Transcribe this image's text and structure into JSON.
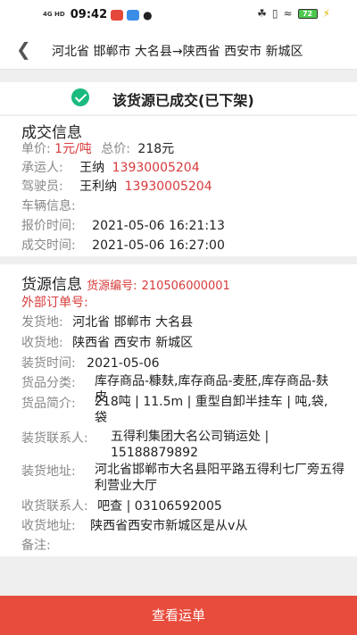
{
  "status_bar": {
    "network": "4G HD",
    "time": "09:42",
    "battery": "72",
    "colors": {
      "app1": "#e6473b",
      "app2": "#3b8ee6"
    },
    "icons": [
      "bluetooth-icon",
      "signal-icon",
      "wifi-icon",
      "battery-icon",
      "chat-icon"
    ]
  },
  "header": {
    "back_icon": "back-arrow-icon",
    "title": "河北省 邯郸市 大名县→陕西省 西安市 新城区"
  },
  "banner": {
    "icon": "check-circle-icon",
    "text": "该货源已成交(已下架)",
    "colors": {
      "icon": "#1aba7e"
    }
  },
  "deal_info": {
    "title": "成交信息",
    "unit_price_label": "单价:",
    "unit_price": "1元/吨",
    "total_price_label": "总价:",
    "total_price": "218元",
    "carrier_label": "承运人:",
    "carrier_name": "王纳",
    "carrier_phone": "13930005204",
    "driver_label": "驾驶员:",
    "driver_name": "王利纳",
    "driver_phone": "13930005204",
    "vehicle_label": "车辆信息:",
    "quote_time_label": "报价时间:",
    "quote_time": "2021-05-06 16:21:13",
    "deal_time_label": "成交时间:",
    "deal_time": "2021-05-06 16:27:00"
  },
  "cargo_info": {
    "title": "货源信息",
    "number_label": "货源编号:",
    "number": "210506000001",
    "external_order_label": "外部订单号:",
    "origin_label": "发货地:",
    "origin": "河北省 邯郸市 大名县",
    "destination_label": "收货地:",
    "destination": "陕西省 西安市 新城区",
    "load_time_label": "装货时间:",
    "load_time": "2021-05-06",
    "goods_category_label": "货品分类:",
    "goods_category": "库存商品-糠麸,库存商品-麦胚,库存商品-麸皮",
    "goods_brief_label": "货品简介:",
    "goods_brief": "218吨 | 11.5m | 重型自卸半挂车 | 吨,袋, 袋",
    "load_contact_label": "装货联系人:",
    "load_contact": "五得利集团大名公司销运处 | 15188879892",
    "load_address_label": "装货地址:",
    "load_address": "河北省邯郸市大名县阳平路五得利七厂旁五得利营业大厅",
    "unload_contact_label": "收货联系人:",
    "unload_contact": "吧查 | 03106592005",
    "unload_address_label": "收货地址:",
    "unload_address": "陕西省西安市新城区是从v从",
    "remark_label": "备注:"
  },
  "bottom_bar": {
    "button_label": "查看运单",
    "colors": {
      "background": "#e84c3d",
      "highlight": "#d83b3b"
    }
  }
}
